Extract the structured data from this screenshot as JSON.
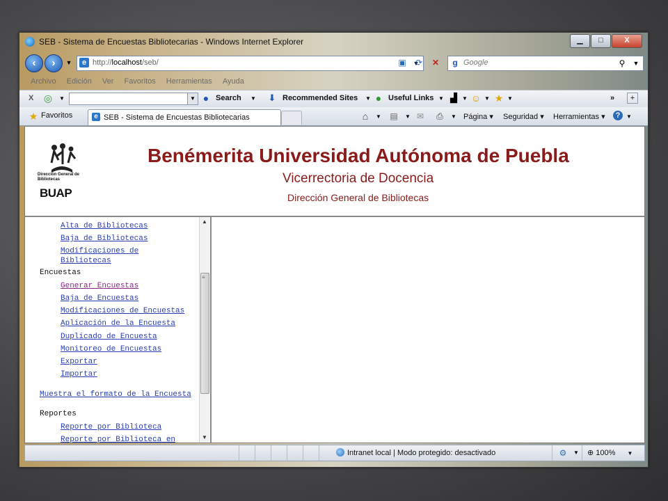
{
  "window": {
    "title": "SEB - Sistema de Encuestas Bibliotecarias - Windows Internet Explorer",
    "min": "▁",
    "max": "□",
    "close": "X"
  },
  "nav": {
    "address_prefix": "http://",
    "address_host": "localhost",
    "address_path": "/seb/",
    "search_placeholder": "Google"
  },
  "menu": [
    "Archivo",
    "Edición",
    "Ver",
    "Favoritos",
    "Herramientas",
    "Ayuda"
  ],
  "toolbar": {
    "close": "X",
    "search": "Search",
    "recommended": "Recommended Sites",
    "useful": "Useful Links",
    "chevron": "»",
    "plus": "+"
  },
  "favbar": {
    "favorites": "Favoritos",
    "tab_title": "SEB - Sistema de Encuestas Bibliotecarias",
    "pagina": "Página",
    "seguridad": "Seguridad",
    "herramientas": "Herramientas",
    "help": "?"
  },
  "header": {
    "logo_line1": "Dirección General de Bibliotecas",
    "logo_line2": "BUAP",
    "title": "Benémerita Universidad Autónoma de Puebla",
    "subtitle": "Vicerrectoria de Docencia",
    "subtitle2": "Dirección General de Bibliotecas"
  },
  "sidebar": {
    "biblio_links": [
      "Alta de Bibliotecas",
      "Baja de Bibliotecas",
      "Modificaciones de",
      "Bibliotecas"
    ],
    "encuestas_label": "Encuestas",
    "encuestas_links": [
      "Generar Encuestas",
      "Baja de Encuestas",
      "Modificaciones de Encuestas",
      "Aplicación de la Encuesta",
      "Duplicado de Encuesta",
      "Monitoreo de Encuestas",
      "Exportar",
      "Importar"
    ],
    "muestra": "Muestra el formato de la Encuesta",
    "reportes_label": "Reportes",
    "reportes_links": [
      "Reporte por Biblioteca",
      "Reporte por Biblioteca en"
    ]
  },
  "status": {
    "zone": "Intranet local | Modo protegido: desactivado",
    "zoom": "100%"
  }
}
